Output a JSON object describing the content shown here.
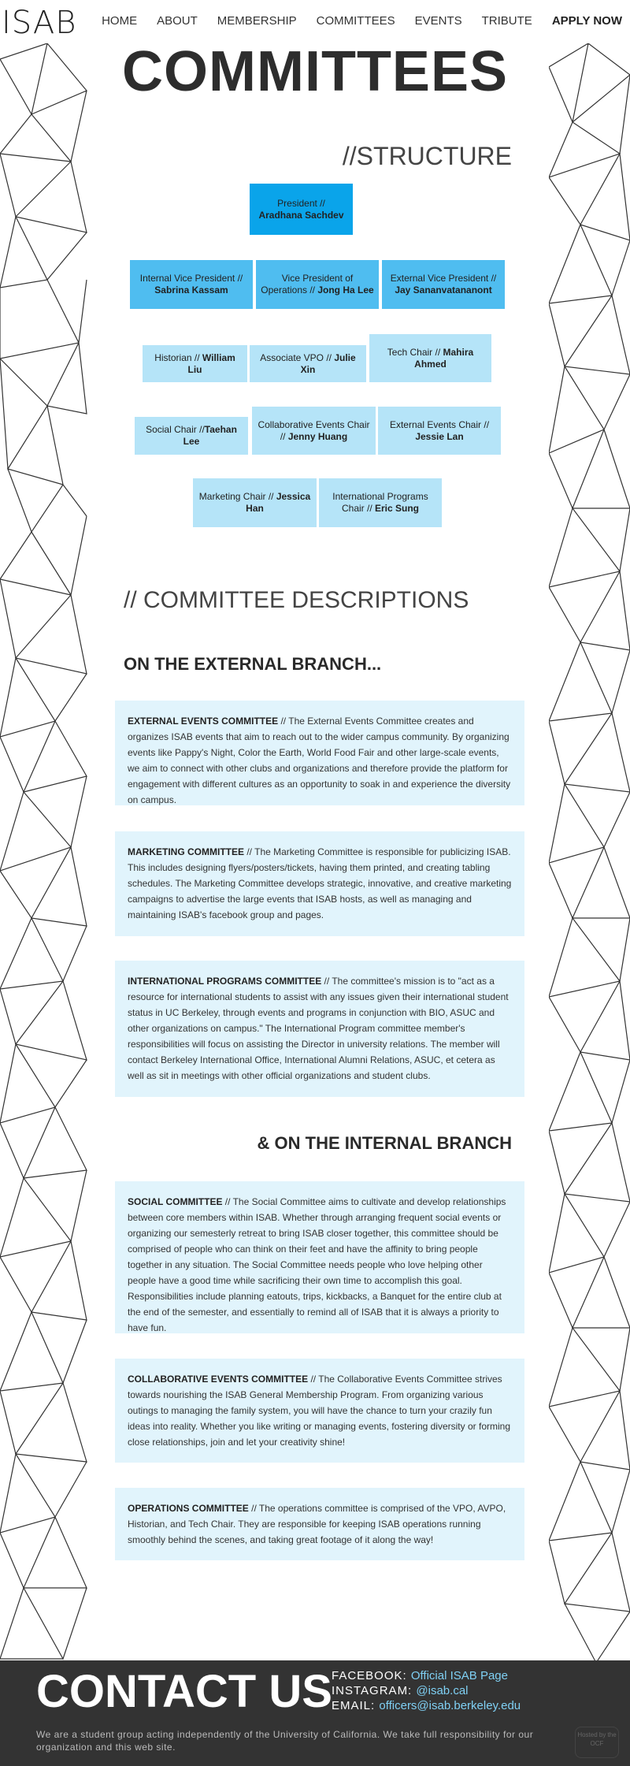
{
  "header": {
    "logo": "ISAB",
    "nav": [
      "HOME",
      "ABOUT",
      "MEMBERSHIP",
      "COMMITTEES",
      "EVENTS",
      "TRIBUTE"
    ],
    "apply": "APPLY NOW"
  },
  "page_title": "COMMITTEES",
  "structure": {
    "heading": "//STRUCTURE",
    "president": {
      "role": "President // ",
      "name": "Aradhana Sachdev"
    },
    "row2": [
      {
        "role": "Internal Vice President // ",
        "name": "Sabrina Kassam"
      },
      {
        "role": "Vice President of Operations // ",
        "name": "Jong Ha Lee"
      },
      {
        "role": "External Vice President // ",
        "name": "Jay Sananvatananont"
      }
    ],
    "row3": [
      {
        "role": "Historian // ",
        "name": "William Liu"
      },
      {
        "role": "Associate VPO // ",
        "name": "Julie Xin"
      },
      {
        "role": "Tech Chair // ",
        "name": "Mahira Ahmed"
      }
    ],
    "row4": [
      {
        "role": "Social Chair //",
        "name": "Taehan Lee"
      },
      {
        "role": "Collaborative Events Chair // ",
        "name": "Jenny Huang"
      },
      {
        "role": "External Events Chair // ",
        "name": "Jessie Lan"
      }
    ],
    "row5": [
      {
        "role": "Marketing Chair // ",
        "name": "Jessica Han"
      },
      {
        "role": "International Programs Chair // ",
        "name": "Eric Sung"
      }
    ]
  },
  "descriptions_heading": "// COMMITTEE DESCRIPTIONS",
  "external_heading": "ON THE EXTERNAL BRANCH...",
  "internal_heading": "& ON THE INTERNAL BRANCH",
  "external": [
    {
      "title": "EXTERNAL EVENTS COMMITTEE",
      "text": " // The External Events Committee creates and organizes ISAB events that aim to reach out to the wider campus community. By organizing events like Pappy's Night, Color the Earth, World Food Fair and other large-scale events, we aim to connect with other clubs and organizations and therefore provide the platform for engagement with different cultures as an opportunity to soak in and experience the diversity on campus."
    },
    {
      "title": "MARKETING COMMITTEE",
      "text": " // The Marketing Committee is responsible for publicizing ISAB. This includes designing flyers/posters/tickets, having them printed, and creating tabling schedules. The Marketing Committee develops strategic, innovative, and creative marketing campaigns to advertise the large events that ISAB hosts, as well as managing and maintaining ISAB's facebook group and pages."
    },
    {
      "title": "INTERNATIONAL PROGRAMS COMMITTEE",
      "text": " // The committee's mission is to \"act as a resource for international students to assist with any issues given their international student status in UC Berkeley, through events and programs in conjunction with BIO, ASUC and other organizations on campus.\" The International Program committee member's responsibilities will focus on assisting the Director in university relations. The member will contact Berkeley International Office, International Alumni Relations, ASUC, et cetera as well as sit in meetings with other official organizations and student clubs."
    }
  ],
  "internal": [
    {
      "title": "SOCIAL COMMITTEE",
      "text": " // The Social Committee aims to cultivate and develop relationships between core members within ISAB. Whether through arranging frequent social events or organizing our semesterly retreat to bring ISAB closer together, this committee should be comprised of people who can think on their feet and have the affinity to bring people together in any situation. The Social Committee needs people who love helping other people have a good time while sacrificing their own time to accomplish this goal. Responsibilities include planning eatouts, trips, kickbacks, a Banquet for the entire club at the end of the semester, and essentially to remind all of ISAB that it is always a priority to have fun."
    },
    {
      "title": "COLLABORATIVE EVENTS COMMITTEE",
      "text": " // The Collaborative Events Committee strives towards nourishing the ISAB General Membership Program. From organizing various outings to managing the family system, you will have the chance to turn your crazily fun ideas into reality. Whether you like writing or managing events, fostering diversity or forming close relationships, join and let your creativity shine!"
    },
    {
      "title": "OPERATIONS COMMITTEE",
      "text": " // The operations committee is comprised of the VPO, AVPO, Historian, and Tech Chair. They are responsible for keeping ISAB operations running smoothly behind the scenes, and taking great footage of it along the way!"
    }
  ],
  "footer": {
    "contact": "CONTACT US",
    "facebook_label": "FACEBOOK: ",
    "facebook_value": "Official ISAB Page",
    "instagram_label": "INSTAGRAM: ",
    "instagram_value": "@isab.cal",
    "email_label": "EMAIL: ",
    "email_value": "officers@isab.berkeley.edu",
    "disclaimer": "We are a student group acting independently of the University of California. We take full responsibility for our organization and this web site.",
    "badge": "Hosted by the OCF"
  }
}
